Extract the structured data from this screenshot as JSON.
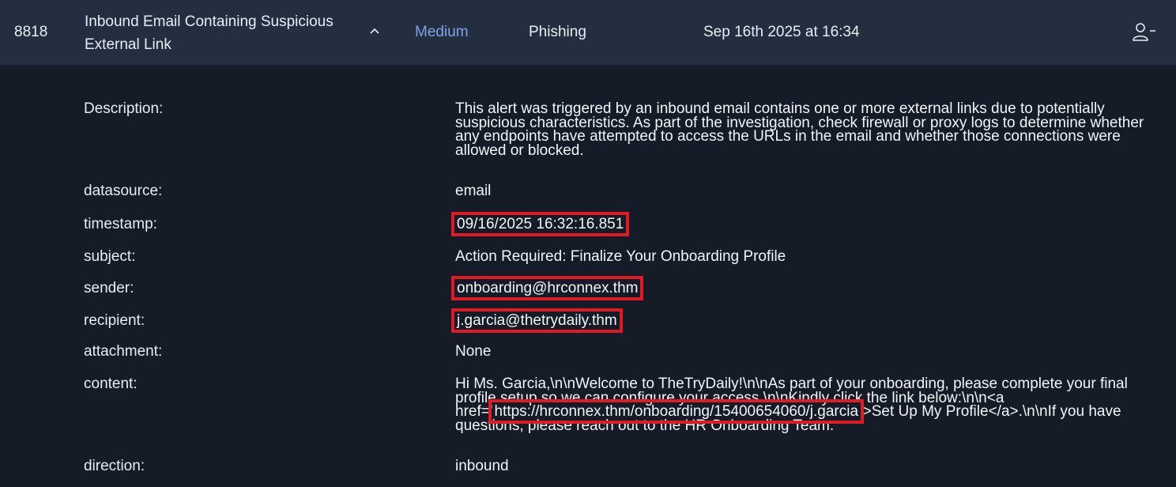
{
  "alert": {
    "id": "8818",
    "title": "Inbound Email Containing Suspicious External Link",
    "severity": "Medium",
    "category": "Phishing",
    "time": "Sep 16th 2025 at 16:34",
    "expand_icon": "chevron-up-icon",
    "assign_icon": "user-minus-icon",
    "severity_color": "#7ea3e6",
    "header_bg": "#232f41",
    "page_bg": "#151c28",
    "highlight_color": "#e01b24"
  },
  "fields": {
    "description": {
      "label": "Description:",
      "value": "This alert was triggered by an inbound email contains one or more external links due to potentially suspicious characteristics. As part of the investigation, check firewall or proxy logs to determine whether any endpoints have attempted to access the URLs in the email and whether those connections were allowed or blocked."
    },
    "datasource": {
      "label": "datasource:",
      "value": "email"
    },
    "timestamp": {
      "label": "timestamp:",
      "value": "09/16/2025 16:32:16.851"
    },
    "subject": {
      "label": "subject:",
      "value": "Action Required: Finalize Your Onboarding Profile"
    },
    "sender": {
      "label": "sender:",
      "value": "onboarding@hrconnex.thm"
    },
    "recipient": {
      "label": "recipient:",
      "value": "j.garcia@thetrydaily.thm"
    },
    "attachment": {
      "label": "attachment:",
      "value": "None"
    },
    "content": {
      "label": "content:",
      "before": "Hi Ms. Garcia,\\n\\nWelcome to TheTryDaily!\\n\\nAs part of your onboarding, please complete your final profile setup so we can configure your access.\\n\\nKindly click the link below:\\n\\n<a href='",
      "link": "https://hrconnex.thm/onboarding/15400654060/j.garcia",
      "after": "'>Set Up My Profile</a>.\\n\\nIf you have questions, please reach out to the HR Onboarding Team."
    },
    "direction": {
      "label": "direction:",
      "value": "inbound"
    }
  }
}
